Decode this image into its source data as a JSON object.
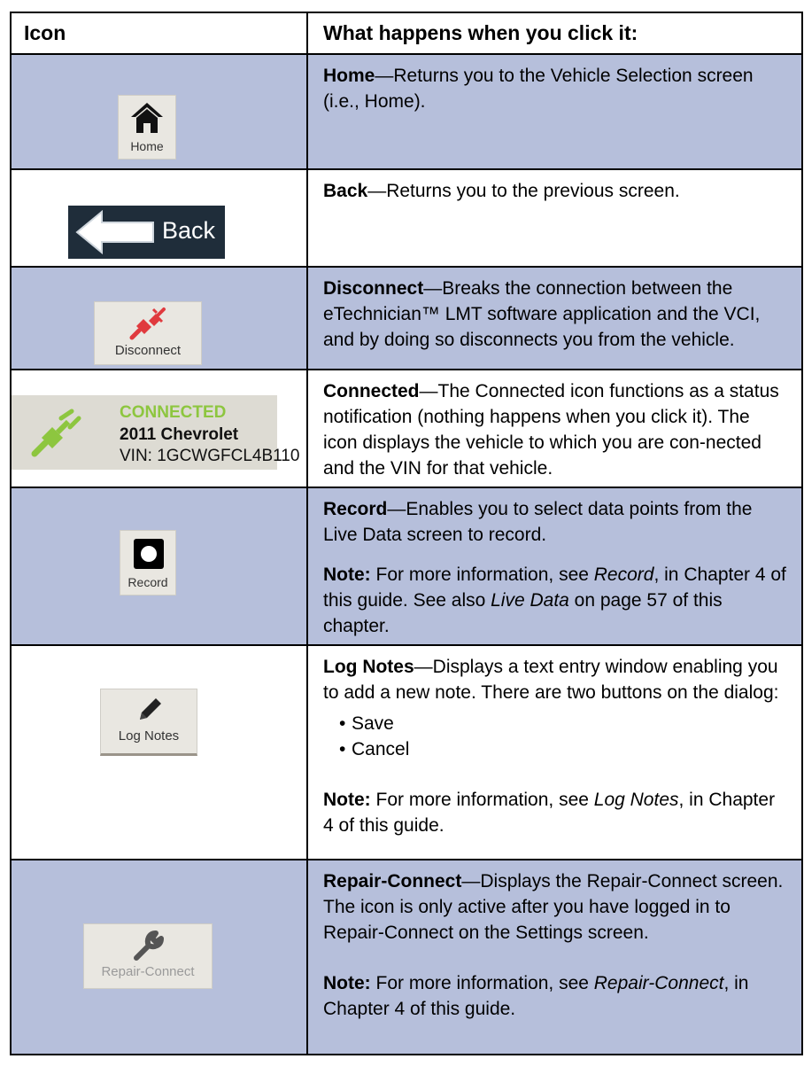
{
  "header": {
    "col_icon": "Icon",
    "col_desc": "What happens when you click it:"
  },
  "rows": [
    {
      "icon_label": "Home",
      "title": "Home",
      "text": "—Returns you to the Vehicle Selection screen (i.e., Home)."
    },
    {
      "icon_label": "Back",
      "title": "Back",
      "text": "—Returns you to the previous screen."
    },
    {
      "icon_label": "Disconnect",
      "title": "Disconnect",
      "text": "—Breaks the connection between the eTechnician™ LMT software application and the VCI, and by doing so disconnects you from the vehicle."
    },
    {
      "icon_status": "CONNECTED",
      "icon_vehicle": "2011 Chevrolet",
      "icon_vin": "VIN: 1GCWGFCL4B110",
      "title": "Connected",
      "text": "—The Connected icon functions as a status notification (nothing happens when you click it). The icon displays the vehicle to which you are con-nected and the VIN for that vehicle."
    },
    {
      "icon_label": "Record",
      "title": "Record",
      "text": "—Enables you to select data points from the Live Data screen to record.",
      "note_label": "Note:",
      "note_pre": " For more information, see ",
      "note_ital1": "Record",
      "note_mid": ", in Chapter 4 of this guide. See also ",
      "note_ital2": "Live Data",
      "note_post": " on page 57 of this chapter."
    },
    {
      "icon_label": "Log Notes",
      "title": "Log Notes",
      "text": "—Displays a text entry window enabling you to add a new note. There are two buttons on the dialog:",
      "bullets": [
        "Save",
        "Cancel"
      ],
      "note_label": "Note:",
      "note_pre": " For more information, see ",
      "note_ital1": "Log Notes",
      "note_post": ", in Chapter 4 of this guide."
    },
    {
      "icon_label": "Repair-Connect",
      "title": "Repair-Connect",
      "text": "—Displays the Repair-Connect screen. The icon is only active after you have logged in to Repair-Connect on the Settings screen.",
      "note_label": "Note:",
      "note_pre": " For more information, see ",
      "note_ital1": "Repair-Connect",
      "note_post": ", in Chapter 4 of this guide."
    }
  ],
  "colors": {
    "row_shade": "#b6bfdb",
    "connected_green": "#8dc63f",
    "disconnect_red": "#e03a3e"
  }
}
